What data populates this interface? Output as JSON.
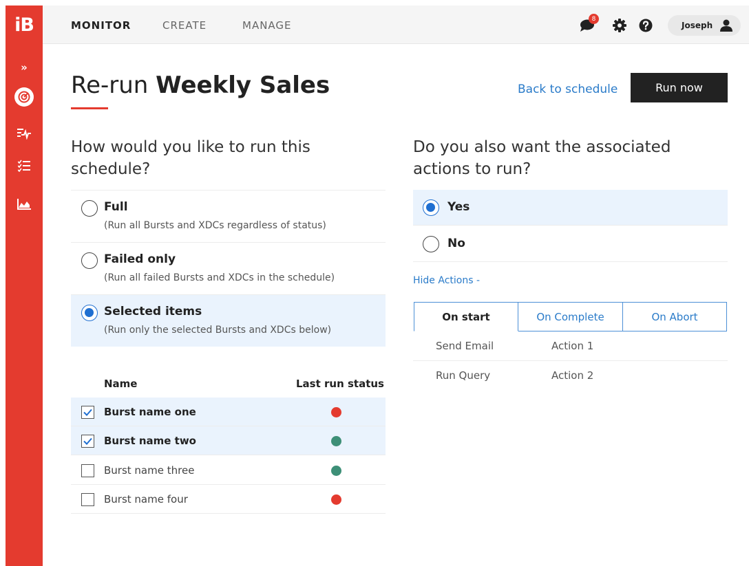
{
  "app": {
    "logo": "iB",
    "brand_color": "#e43b2f",
    "accent_color": "#1f6fd1",
    "link_color": "#2a7bc9"
  },
  "sidebar": {
    "items": [
      {
        "icon": "double-chevron-right-icon",
        "label": "»"
      },
      {
        "icon": "target-icon",
        "active": true
      },
      {
        "icon": "activity-list-icon"
      },
      {
        "icon": "checklist-icon"
      },
      {
        "icon": "area-chart-icon"
      }
    ]
  },
  "nav": {
    "items": [
      "MONITOR",
      "CREATE",
      "MANAGE"
    ],
    "active": "MONITOR",
    "notification_count": "8",
    "user_name": "Joseph"
  },
  "header": {
    "title_prefix": "Re-run",
    "title_name": "Weekly Sales",
    "back_link": "Back to schedule",
    "run_button": "Run now"
  },
  "run_mode": {
    "question": [
      "How would you like to run this",
      "schedule?"
    ],
    "options": [
      {
        "title": "Full",
        "subtitle": "(Run all Bursts and XDCs regardless of status)",
        "selected": false
      },
      {
        "title": "Failed only",
        "subtitle": "(Run all failed Bursts and XDCs in the schedule)",
        "selected": false
      },
      {
        "title": "Selected items",
        "subtitle": "(Run only the selected Bursts and XDCs below)",
        "selected": true
      }
    ]
  },
  "items_table": {
    "columns": [
      "Name",
      "Last run status"
    ],
    "rows": [
      {
        "name": "Burst name one",
        "checked": true,
        "status_color": "#e43b2f"
      },
      {
        "name": "Burst name two",
        "checked": true,
        "status_color": "#3d8f77"
      },
      {
        "name": "Burst name three",
        "checked": false,
        "status_color": "#3d8f77"
      },
      {
        "name": "Burst name four",
        "checked": false,
        "status_color": "#e43b2f"
      }
    ]
  },
  "actions_choice": {
    "question": [
      "Do you also want the associated",
      "actions to run?"
    ],
    "options": [
      {
        "label": "Yes",
        "selected": true
      },
      {
        "label": "No",
        "selected": false
      }
    ],
    "toggle_link": "Hide Actions -"
  },
  "action_tabs": {
    "tabs": [
      "On start",
      "On Complete",
      "On Abort"
    ],
    "active": "On start",
    "rows": [
      {
        "type": "Send Email",
        "name": "Action 1"
      },
      {
        "type": "Run Query",
        "name": "Action 2"
      }
    ]
  }
}
